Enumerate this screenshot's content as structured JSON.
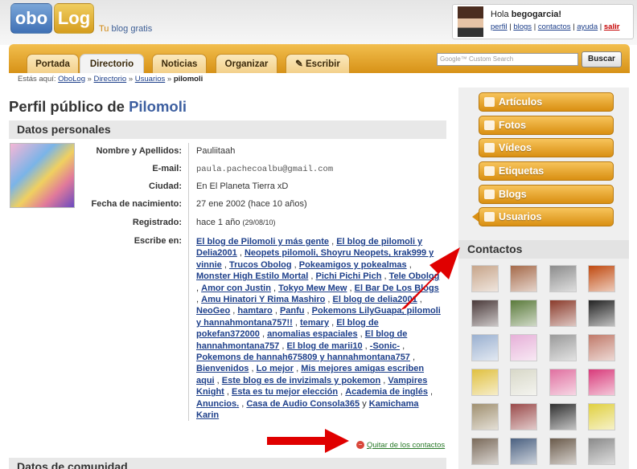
{
  "header": {
    "logo_left": "obo",
    "logo_right": "Log",
    "tagline_prefix": "Tu",
    "tagline_rest": " blog gratis",
    "greeting_prefix": "Hola ",
    "username": "begogarcia!",
    "user_links": [
      "perfil",
      "blogs",
      "contactos",
      "ayuda"
    ],
    "logout": "salir"
  },
  "nav": {
    "tabs": [
      "Portada",
      "Directorio",
      "Noticias",
      "Organizar",
      "Escribir"
    ],
    "active": "Directorio",
    "search_placeholder": "Google™ Custom Search",
    "search_button": "Buscar"
  },
  "breadcrumb": {
    "prefix": "Estás aquí:",
    "items": [
      "OboLog",
      "Directorio",
      "Usuarios"
    ],
    "current": "pilomoli"
  },
  "profile": {
    "title_prefix": "Perfil público de ",
    "name": "Pilomoli",
    "section_title": "Datos personales",
    "fields": {
      "name_label": "Nombre y Apellidos:",
      "name_value": "Pauliitaah",
      "email_label": "E-mail:",
      "email_value": "paula.pachecoalbu@gmail.com",
      "city_label": "Ciudad:",
      "city_value": "En El Planeta Tierra xD",
      "birth_label": "Fecha de nacimiento:",
      "birth_value": "27 ene 2002 (hace 10 años)",
      "reg_label": "Registrado:",
      "reg_value": "hace 1 año",
      "reg_date": "(29/08/10)",
      "writes_label": "Escribe en:"
    },
    "blogs": [
      "El blog de Pilomoli y más gente",
      "El blog de pilomoli y Delia2001",
      "Neopets pilomoli, Shoyru Neopets, krak999 y vinnie",
      "Trucos Obolog",
      "Pokeamigos y pokealmas",
      "Monster High Estilo Mortal",
      "Pichi Pichi Pich",
      "Tele Obolog",
      "Amor con Justin",
      "Tokyo Mew Mew",
      "El Bar De Los Blogs",
      "Amu Hinatori Y Rima Mashiro",
      "El blog de delia2001",
      "NeoGeo",
      "hamtaro",
      "Panfu",
      "Pokemons LilyGuapa, pilomoli y hannahmontana757!!",
      "temary",
      "El blog de pokefan372000",
      "anomalias espaciales",
      "El blog de hannahmontana757",
      "El blog de marii10",
      "-Sonic-",
      "Pokemons de hannah675809 y hannahmontana757",
      "Bienvenidos",
      "Lo mejor",
      "Mis mejores amigas escriben aqui",
      "Este blog es de invizimals y pokemon",
      "Vampires Knight",
      "Esta es tu mejor elección",
      "Academia de inglés",
      "Anuncios.",
      "Casa de Audio Consola365",
      "Kamichama Karin"
    ],
    "remove_contact": "Quitar de los contactos",
    "community_title": "Datos de comunidad"
  },
  "sidebar": {
    "buttons": [
      "Artículos",
      "Fotos",
      "Vídeos",
      "Etiquetas",
      "Blogs",
      "Usuarios"
    ],
    "active": "Usuarios",
    "contacts_title": "Contactos"
  },
  "colors": {
    "accent_orange": "#d98f12",
    "link_blue": "#1d3f8a",
    "arrow_red": "#e00000"
  }
}
